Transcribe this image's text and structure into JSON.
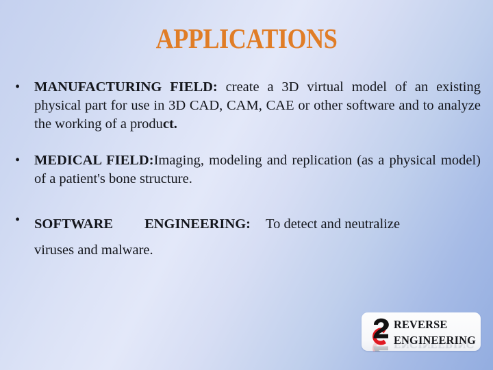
{
  "slide": {
    "title": "APPLICATIONS",
    "title_color": "#e07d27",
    "background_colors": [
      "#c5d1ef",
      "#e3e8f9",
      "#93ade0"
    ],
    "body_text_color": "#14161c",
    "bullet_marker": "•"
  },
  "bullets": [
    {
      "marker": "•",
      "lead": "MANUFACTURING  FIELD:",
      "rest": "create a 3D virtual model   of an existing physical part for use in 3D  CAD, CAM, CAE or other software and to  analyze the working of a produ",
      "rest_bold_tail": "ct."
    },
    {
      "marker": "•",
      "lead": "MEDICAL  FIELD:",
      "rest": "Imaging, modeling and replication   (as a physical model) of a patient's bone  structure."
    },
    {
      "marker": "•",
      "lead_part1": "SOFTWARE",
      "lead_part2": "ENGINEERING:",
      "rest_line1": "To  detect  and  neutralize",
      "rest_line2": "viruses and malware."
    }
  ],
  "logo": {
    "line1": "REVERSE",
    "line2": "ENGINEERING",
    "mark_name": "reverse-engineering-emblem",
    "mark_colors": {
      "swoosh": "#111111",
      "ring": "#e01b22"
    }
  }
}
